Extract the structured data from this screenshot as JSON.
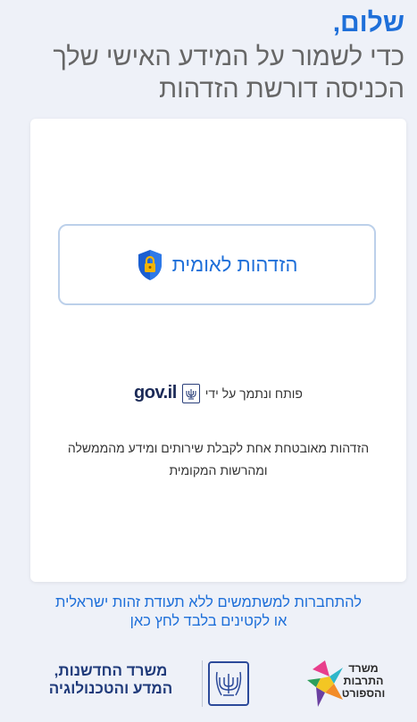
{
  "header": {
    "greeting": "שלום,",
    "subtitle": "כדי לשמור על המידע האישי שלך הכניסה דורשת הזדהות"
  },
  "card": {
    "button": {
      "label": "הזדהות לאומית",
      "icon": "shield-lock-icon"
    },
    "provider_text": "פותח ונתמך על ידי",
    "provider_logo": "gov.il",
    "description": "הזדהות מאובטחת אחת לקבלת שירותים ומידע מהממשלה ומהרשות המקומית"
  },
  "alt_link": {
    "line1": "להתחברות למשתמשים ללא תעודת זהות ישראלית",
    "line2": "או לקטינים בלבד לחץ כאן"
  },
  "footer": {
    "culture_ministry": [
      "משרד",
      "התרבות",
      "והספורט"
    ],
    "innovation_ministry": [
      "משרד החדשנות,",
      "המדע והטכנולוגיה"
    ]
  },
  "colors": {
    "accent": "#1e6fd9",
    "background": "#eef1f8",
    "navy": "#1f3a7a"
  }
}
